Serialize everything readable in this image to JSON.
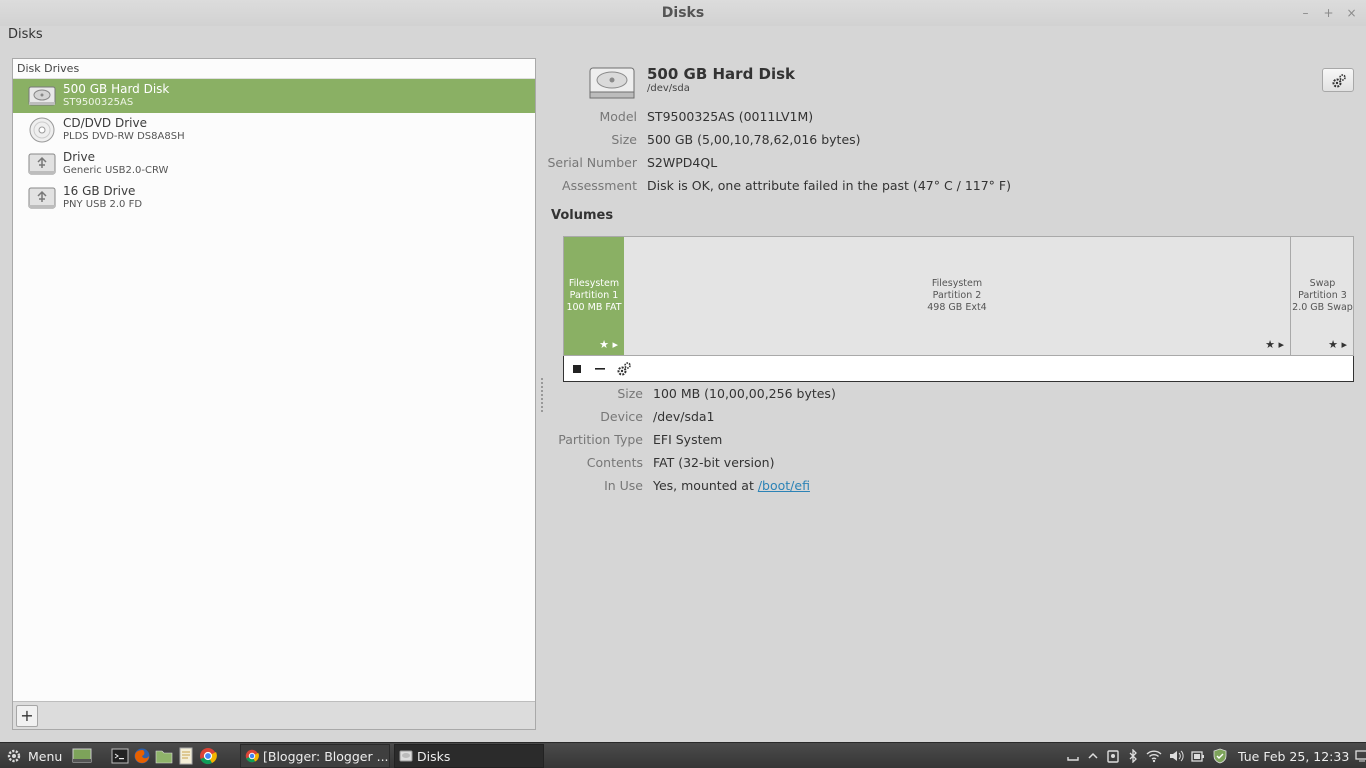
{
  "window": {
    "title": "Disks"
  },
  "menubar": {
    "app_menu": "Disks"
  },
  "drives_panel": {
    "header": "Disk Drives",
    "drives": [
      {
        "name": "500 GB Hard Disk",
        "sub": "ST9500325AS",
        "icon": "hard-disk-icon"
      },
      {
        "name": "CD/DVD Drive",
        "sub": "PLDS DVD-RW DS8A8SH",
        "icon": "optical-drive-icon"
      },
      {
        "name": "Drive",
        "sub": "Generic USB2.0-CRW",
        "icon": "usb-drive-icon"
      },
      {
        "name": "16 GB Drive",
        "sub": "PNY USB 2.0 FD",
        "icon": "usb-drive-icon"
      }
    ],
    "add_label": "+"
  },
  "disk": {
    "title": "500 GB Hard Disk",
    "path": "/dev/sda",
    "props": [
      {
        "k": "Model",
        "v": "ST9500325AS (0011LV1M)"
      },
      {
        "k": "Size",
        "v": "500 GB (5,00,10,78,62,016 bytes)"
      },
      {
        "k": "Serial Number",
        "v": "S2WPD4QL"
      },
      {
        "k": "Assessment",
        "v": "Disk is OK, one attribute failed in the past (47° C / 117° F)"
      }
    ]
  },
  "volumes": {
    "title": "Volumes",
    "segments": [
      {
        "l1": "Filesystem",
        "l2": "Partition 1",
        "l3": "100 MB FAT",
        "marks": "★ ▸"
      },
      {
        "l1": "Filesystem",
        "l2": "Partition 2",
        "l3": "498 GB Ext4",
        "marks": "★ ▸"
      },
      {
        "l1": "Swap",
        "l2": "Partition 3",
        "l3": "2.0 GB Swap",
        "marks": "★ ▸"
      }
    ]
  },
  "partition": {
    "props": [
      {
        "k": "Size",
        "v": "100 MB (10,00,00,256 bytes)"
      },
      {
        "k": "Device",
        "v": "/dev/sda1"
      },
      {
        "k": "Partition Type",
        "v": "EFI System"
      },
      {
        "k": "Contents",
        "v": "FAT (32-bit version)"
      },
      {
        "k": "In Use",
        "v": "Yes, mounted at ",
        "link": "/boot/efi"
      }
    ]
  },
  "taskbar": {
    "menu_label": "Menu",
    "windows": [
      {
        "label": "[Blogger: Blogger ...",
        "icon": "chrome-icon"
      },
      {
        "label": "Disks",
        "icon": "disks-icon"
      }
    ],
    "clock": "Tue Feb 25, 12:33"
  }
}
